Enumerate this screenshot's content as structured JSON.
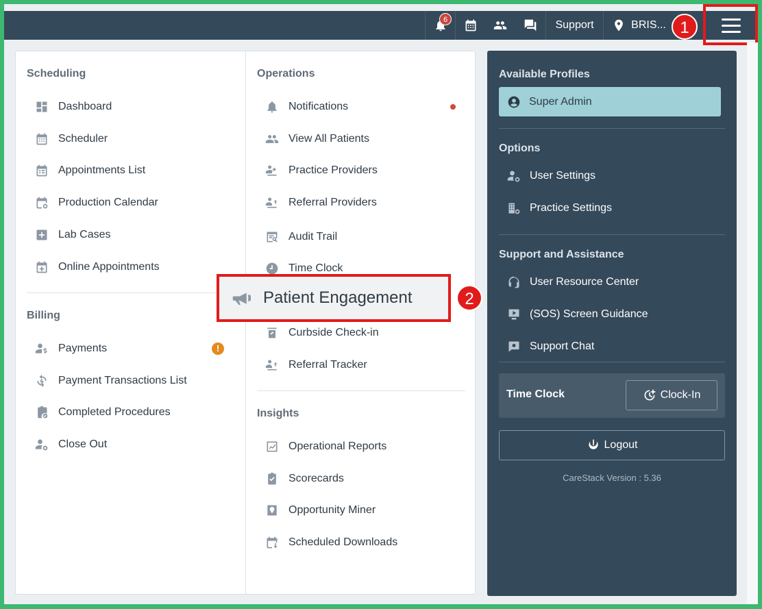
{
  "topbar": {
    "notification_count": "6",
    "support_label": "Support",
    "location_label": "BRIS..."
  },
  "steps": {
    "one": "1",
    "two": "2"
  },
  "scheduling": {
    "title": "Scheduling",
    "items": [
      "Dashboard",
      "Scheduler",
      "Appointments List",
      "Production Calendar",
      "Lab Cases",
      "Online Appointments"
    ]
  },
  "billing": {
    "title": "Billing",
    "items": [
      "Payments",
      "Payment Transactions List",
      "Completed Procedures",
      "Close Out"
    ],
    "warn_badge": "!"
  },
  "operations": {
    "title": "Operations",
    "items": [
      "Notifications",
      "View All Patients",
      "Practice Providers",
      "Referral Providers",
      "Audit Trail",
      "Time Clock",
      "Patient Engagement",
      "Curbside Check-in",
      "Referral Tracker"
    ]
  },
  "insights": {
    "title": "Insights",
    "items": [
      "Operational Reports",
      "Scorecards",
      "Opportunity Miner",
      "Scheduled Downloads"
    ]
  },
  "right_panel": {
    "profiles_title": "Available Profiles",
    "profile": "Super Admin",
    "options_title": "Options",
    "options": [
      "User Settings",
      "Practice Settings"
    ],
    "support_title": "Support and Assistance",
    "support_items": [
      "User Resource Center",
      "(SOS) Screen Guidance",
      "Support Chat"
    ],
    "time_clock_label": "Time Clock",
    "clock_in_label": "Clock-In",
    "logout_label": "Logout",
    "version": "CareStack Version : 5.36"
  },
  "colors": {
    "topbar": "#34495a",
    "accent_red": "#e11b1b",
    "profile_bg": "#9fd0d8",
    "frame_green": "#3db870"
  }
}
